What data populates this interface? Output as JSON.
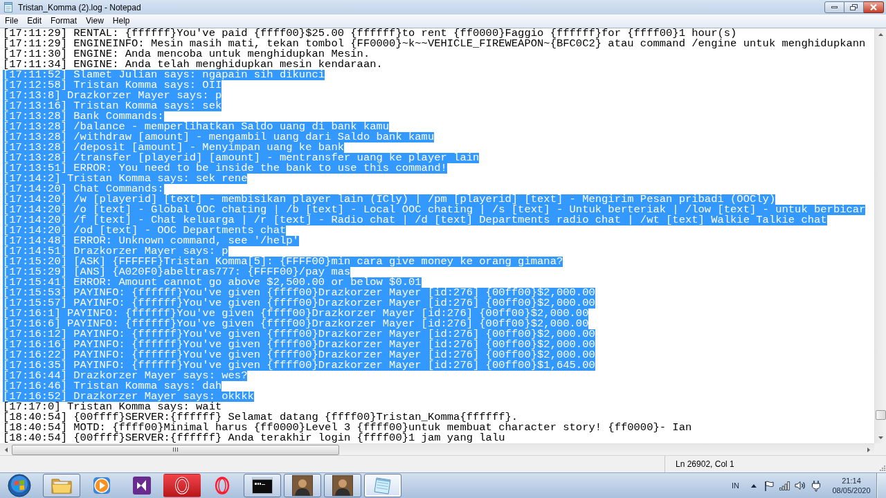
{
  "window": {
    "title": "Tristan_Komma (2).log - Notepad"
  },
  "menu": [
    "File",
    "Edit",
    "Format",
    "View",
    "Help"
  ],
  "lines": [
    {
      "text": "[17:11:29] RENTAL: {ffffff}You've paid {ffff00}$25.00 {ffffff}to rent {ff0000}Faggio {ffffff}for {ffff00}1 hour(s)",
      "selected": false
    },
    {
      "text": "[17:11:29] ENGINEINFO: Mesin masih mati, tekan tombol {FF0000}~k~~VEHICLE_FIREWEAPON~{BFC0C2} atau command /engine untuk menghidupkann",
      "selected": false
    },
    {
      "text": "[17:11:30] ENGINE: Anda mencoba untuk menghidupkan Mesin.",
      "selected": false
    },
    {
      "text": "[17:11:34] ENGINE: Anda telah menghidupkan mesin kendaraan.",
      "selected": false
    },
    {
      "text": "[17:11:52] Slamet Julian says: ngapain sih dikunci",
      "selected": true
    },
    {
      "text": "[17:12:58] Tristan Komma says: OII",
      "selected": true
    },
    {
      "text": "[17:13:8] Drazkorzer Mayer says: p",
      "selected": true
    },
    {
      "text": "[17:13:16] Tristan Komma says: sek",
      "selected": true
    },
    {
      "text": "[17:13:28] Bank Commands:",
      "selected": true
    },
    {
      "text": "[17:13:28] /balance - memperlihatkan Saldo uang di bank kamu",
      "selected": true
    },
    {
      "text": "[17:13:28] /withdraw [amount] - mengambil uang dari Saldo bank kamu",
      "selected": true
    },
    {
      "text": "[17:13:28] /deposit [amount] - Menyimpan uang ke bank",
      "selected": true
    },
    {
      "text": "[17:13:28] /transfer [playerid] [amount] - mentransfer uang ke player lain",
      "selected": true
    },
    {
      "text": "[17:13:51] ERROR: You need to be inside the bank to use this command!",
      "selected": true
    },
    {
      "text": "[17:14:2] Tristan Komma says: sek rene",
      "selected": true
    },
    {
      "text": "[17:14:20] Chat Commands:",
      "selected": true
    },
    {
      "text": "[17:14:20] /w [playerid] [text] - membisikan player lain (ICly) | /pm [playerid] [text] - Mengirim Pesan pribadi (OOCly)",
      "selected": true
    },
    {
      "text": "[17:14:20] /o [text] - Global OOC chating | /b [text] - Local OOC chating | /s [text] - Untuk berteriak | /low [text] - untuk berbicar",
      "selected": true
    },
    {
      "text": "[17:14:20] /f [text] - Chat keluarga | /r [text] - Radio chat | /d [text] Departments radio chat | /wt [text] Walkie Talkie chat",
      "selected": true
    },
    {
      "text": "[17:14:20] /od [text] - OOC Departments chat",
      "selected": true
    },
    {
      "text": "[17:14:48] ERROR: Unknown command, see '/help'",
      "selected": true
    },
    {
      "text": "[17:14:51] Drazkorzer Mayer says: p",
      "selected": true
    },
    {
      "text": "[17:15:20] [ASK] {FFFFFF}Tristan Komma[5]: {FFFF00}min cara give money ke orang gimana?",
      "selected": true
    },
    {
      "text": "[17:15:29] [ANS] {A020F0}abeltras777: {FFFF00}/pay mas",
      "selected": true
    },
    {
      "text": "[17:15:41] ERROR: Amount cannot go above $2,500.00 or below $0.01",
      "selected": true
    },
    {
      "text": "[17:15:53] PAYINFO: {ffffff}You've given {ffff00}Drazkorzer Mayer [id:276] {00ff00}$2,000.00",
      "selected": true
    },
    {
      "text": "[17:15:57] PAYINFO: {ffffff}You've given {ffff00}Drazkorzer Mayer [id:276] {00ff00}$2,000.00",
      "selected": true
    },
    {
      "text": "[17:16:1] PAYINFO: {ffffff}You've given {ffff00}Drazkorzer Mayer [id:276] {00ff00}$2,000.00",
      "selected": true
    },
    {
      "text": "[17:16:6] PAYINFO: {ffffff}You've given {ffff00}Drazkorzer Mayer [id:276] {00ff00}$2,000.00",
      "selected": true
    },
    {
      "text": "[17:16:12] PAYINFO: {ffffff}You've given {ffff00}Drazkorzer Mayer [id:276] {00ff00}$2,000.00",
      "selected": true
    },
    {
      "text": "[17:16:16] PAYINFO: {ffffff}You've given {ffff00}Drazkorzer Mayer [id:276] {00ff00}$2,000.00",
      "selected": true
    },
    {
      "text": "[17:16:22] PAYINFO: {ffffff}You've given {ffff00}Drazkorzer Mayer [id:276] {00ff00}$2,000.00",
      "selected": true
    },
    {
      "text": "[17:16:35] PAYINFO: {ffffff}You've given {ffff00}Drazkorzer Mayer [id:276] {00ff00}$1,645.00",
      "selected": true
    },
    {
      "text": "[17:16:44] Drazkorzer Mayer says: wes?",
      "selected": true
    },
    {
      "text": "[17:16:46] Tristan Komma says: dah",
      "selected": true
    },
    {
      "text": "[17:16:52] Drazkorzer Mayer says: okkkk",
      "selected": true
    },
    {
      "text": "[17:17:0] Tristan Komma says: wait",
      "selected": false
    },
    {
      "text": "[18:40:54] {00ffff}SERVER:{ffffff} Selamat datang {ffff00}Tristan_Komma{ffffff}.",
      "selected": false
    },
    {
      "text": "[18:40:54] MOTD: {ffff00}Minimal harus {ff0000}Level 3 {ffff00}untuk membuat character story! {ff0000}- Ian",
      "selected": false
    },
    {
      "text": "[18:40:54] {00ffff}SERVER:{ffffff} Anda terakhir login {ffff00}1 jam yang lalu",
      "selected": false
    }
  ],
  "status_bar": {
    "position": "Ln 26902, Col 1"
  },
  "taskbar": {
    "buttons": [
      {
        "kind": "folder",
        "running": true,
        "hovered": false,
        "selected": false
      },
      {
        "kind": "media",
        "running": false,
        "hovered": false,
        "selected": false
      },
      {
        "kind": "bowtie",
        "running": false,
        "hovered": false,
        "selected": false
      },
      {
        "kind": "ring_tile",
        "running": false,
        "hovered": true,
        "selected": false
      },
      {
        "kind": "ring",
        "running": false,
        "hovered": false,
        "selected": false
      },
      {
        "kind": "terminal",
        "running": true,
        "hovered": false,
        "selected": false
      },
      {
        "kind": "avatar",
        "running": true,
        "hovered": false,
        "selected": false
      },
      {
        "kind": "avatar",
        "running": true,
        "hovered": false,
        "selected": false
      },
      {
        "kind": "notepad",
        "running": true,
        "hovered": false,
        "selected": true
      }
    ],
    "tray": {
      "language": "IN",
      "time": "21:14",
      "date": "08/05/2020"
    }
  }
}
